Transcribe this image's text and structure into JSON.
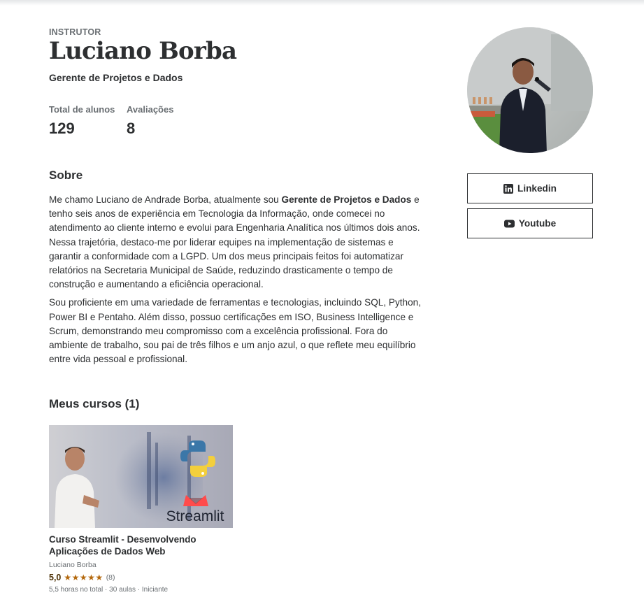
{
  "header": {
    "eyebrow": "INSTRUTOR",
    "name": "Luciano Borba",
    "headline": "Gerente de Projetos e Dados"
  },
  "stats": {
    "students_label": "Total de alunos",
    "students_value": "129",
    "reviews_label": "Avaliações",
    "reviews_value": "8"
  },
  "about": {
    "title": "Sobre",
    "p1_before": "Me chamo Luciano de Andrade Borba, atualmente sou ",
    "p1_bold": "Gerente de Projetos e Dados",
    "p1_after": " e tenho seis anos de experiência em Tecnologia da Informação, onde comecei no atendimento ao cliente interno e evolui para Engenharia Analítica nos últimos dois anos. Nessa trajetória, destaco-me por liderar equipes na implementação de sistemas e garantir a conformidade com a LGPD. Um dos meus principais feitos foi automatizar relatórios na Secretaria Municipal de Saúde, reduzindo drasticamente o tempo de construção e aumentando a eficiência operacional.",
    "p2": "Sou proficiente em uma variedade de ferramentas e tecnologias, incluindo SQL, Python, Power BI e Pentaho. Além disso, possuo certificações em ISO, Business Intelligence e Scrum, demonstrando meu compromisso com a excelência profissional. Fora do ambiente de trabalho, sou pai de três filhos e um anjo azul, o que reflete meu equilíbrio entre vida pessoal e profissional."
  },
  "courses": {
    "title": "Meus cursos (1)",
    "items": [
      {
        "thumb_text": "Streamlit",
        "title": "Curso Streamlit - Desenvolvendo Aplicações de Dados Web",
        "author": "Luciano Borba",
        "rating": "5,0",
        "stars": "★★★★★",
        "rating_count": "(8)",
        "meta": "5,5 horas no total · 30 aulas · Iniciante"
      }
    ]
  },
  "social": {
    "linkedin_label": "Linkedin",
    "youtube_label": "Youtube"
  },
  "colors": {
    "text": "#2d2f31",
    "muted": "#6a6f73",
    "star": "#b4690e",
    "rating": "#4d3105"
  },
  "icons": [
    "linkedin-icon",
    "youtube-icon"
  ]
}
